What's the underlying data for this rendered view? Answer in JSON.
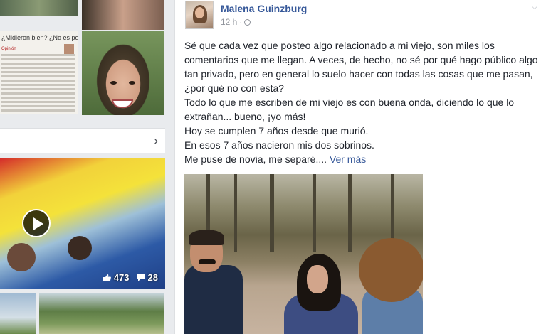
{
  "left_column": {
    "news_headline": "¿Midieron bien? ¿No es poco?",
    "news_section": "Opinión",
    "video_stats": {
      "likes": "473",
      "comments": "28"
    }
  },
  "post": {
    "author": "Malena Guinzburg",
    "timestamp": "12 h",
    "privacy_separator": "·",
    "paragraphs": [
      "Sé que cada vez que posteo algo relacionado a mi viejo, son miles los comentarios que me llegan. A veces, de hecho, no sé por qué hago público algo tan privado, pero en general lo suelo hacer con todas las cosas que me pasan, ¿por qué no con esta?",
      "Todo lo que me escriben de mi viejo es con buena onda, diciendo lo que lo extrañan... bueno, ¡yo más!",
      "Hoy se cumplen 7 años desde que murió.",
      "En esos 7 años nacieron mis dos sobrinos."
    ],
    "truncated_line": "Me puse de novia, me separé....",
    "see_more": "Ver más"
  },
  "icons": {
    "chevron_right": "chevron-right-icon",
    "play": "play-icon",
    "like": "like-icon",
    "comment": "comment-icon",
    "globe": "globe-icon",
    "post_menu": "chevron-down-icon"
  },
  "colors": {
    "link_blue": "#365899",
    "meta_gray": "#90949c",
    "background": "#e9ebee"
  }
}
